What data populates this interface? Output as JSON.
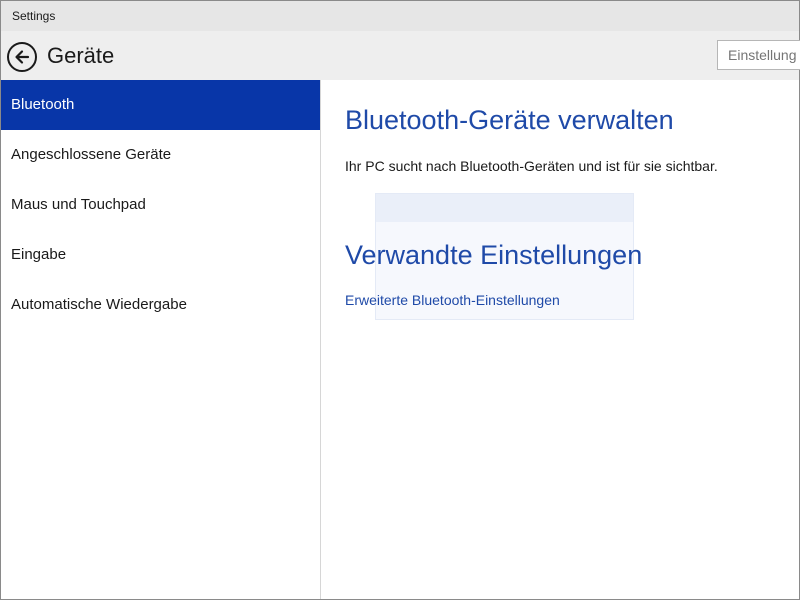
{
  "window": {
    "title": "Settings"
  },
  "header": {
    "page_title": "Geräte",
    "search_placeholder": "Einstellung"
  },
  "sidebar": {
    "items": [
      {
        "label": "Bluetooth",
        "active": true
      },
      {
        "label": "Angeschlossene Geräte"
      },
      {
        "label": "Maus und Touchpad"
      },
      {
        "label": "Eingabe"
      },
      {
        "label": "Automatische Wiedergabe"
      }
    ]
  },
  "main": {
    "section_title": "Bluetooth-Geräte verwalten",
    "status_text": "Ihr PC sucht nach Bluetooth-Geräten und ist für sie sichtbar.",
    "related_title": "Verwandte Einstellungen",
    "related_link": "Erweiterte Bluetooth-Einstellungen"
  },
  "colors": {
    "accent": "#0836a8",
    "link": "#1f4aa8"
  }
}
